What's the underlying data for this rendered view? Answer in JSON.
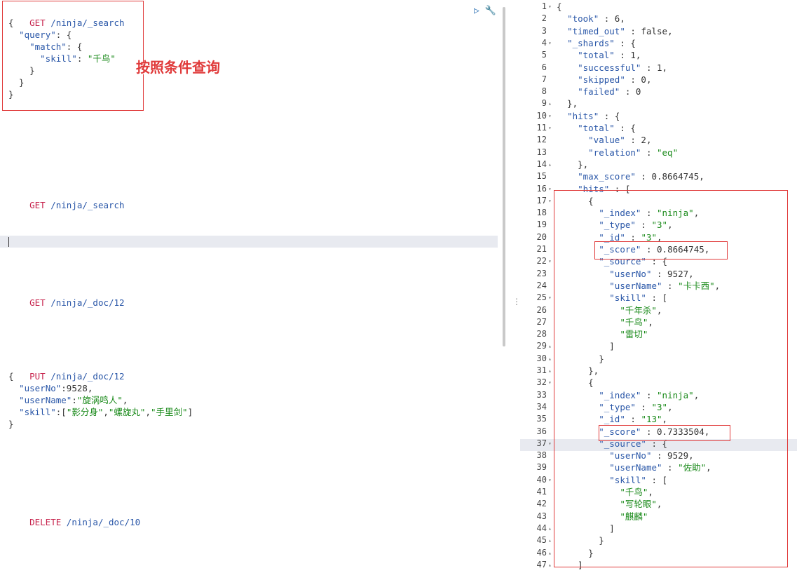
{
  "left_editor": {
    "blocks": [
      {
        "line": "GET /ninja/_search",
        "method": "GET",
        "path": "/ninja/_search"
      },
      {
        "line": "GET /ninja/_search",
        "method": "GET",
        "path": "/ninja/_search"
      },
      {
        "line": "GET /ninja/_doc/12",
        "method": "GET",
        "path": "/ninja/_doc/12"
      },
      {
        "line": "PUT /ninja/_doc/12",
        "method": "PUT",
        "path": "/ninja/_doc/12"
      },
      {
        "line": "DELETE /ninja/_doc/10",
        "method": "DELETE",
        "path": "/ninja/_doc/10"
      }
    ],
    "search_body": [
      "{",
      "  \"query\": {",
      "    \"match\": {",
      "      \"skill\": \"千鸟\"",
      "    }",
      "  }",
      "}"
    ],
    "put_body": [
      "{",
      "  \"userNo\":9528,",
      "  \"userName\":\"旋涡鸣人\",",
      "  \"skill\":[\"影分身\",\"螺旋丸\",\"手里剑\"]",
      "}"
    ],
    "run_icons": [
      "play-icon",
      "wrench-icon"
    ]
  },
  "annotation": "按照条件查询",
  "response": {
    "line_numbers": [
      "1",
      "2",
      "3",
      "4",
      "5",
      "6",
      "7",
      "8",
      "9",
      "10",
      "11",
      "12",
      "13",
      "14",
      "15",
      "16",
      "17",
      "18",
      "19",
      "20",
      "21",
      "22",
      "23",
      "24",
      "25",
      "26",
      "27",
      "28",
      "29",
      "30",
      "31",
      "32",
      "33",
      "34",
      "35",
      "36",
      "37",
      "38",
      "39",
      "40",
      "41",
      "42",
      "43",
      "44",
      "45",
      "46",
      "47"
    ],
    "lines": [
      "{",
      "  \"took\" : 6,",
      "  \"timed_out\" : false,",
      "  \"_shards\" : {",
      "    \"total\" : 1,",
      "    \"successful\" : 1,",
      "    \"skipped\" : 0,",
      "    \"failed\" : 0",
      "  },",
      "  \"hits\" : {",
      "    \"total\" : {",
      "      \"value\" : 2,",
      "      \"relation\" : \"eq\"",
      "    },",
      "    \"max_score\" : 0.8664745,",
      "    \"hits\" : [",
      "      {",
      "        \"_index\" : \"ninja\",",
      "        \"_type\" : \"3\",",
      "        \"_id\" : \"3\",",
      "        \"_score\" : 0.8664745,",
      "        \"_source\" : {",
      "          \"userNo\" : 9527,",
      "          \"userName\" : \"卡卡西\",",
      "          \"skill\" : [",
      "            \"千年杀\",",
      "            \"千鸟\",",
      "            \"雷切\"",
      "          ]",
      "        }",
      "      },",
      "      {",
      "        \"_index\" : \"ninja\",",
      "        \"_type\" : \"3\",",
      "        \"_id\" : \"13\",",
      "        \"_score\" : 0.7333504,",
      "        \"_source\" : {",
      "          \"userNo\" : 9529,",
      "          \"userName\" : \"佐助\",",
      "          \"skill\" : [",
      "            \"千鸟\",",
      "            \"写轮眼\",",
      "            \"麒麟\"",
      "          ]",
      "        }",
      "      }",
      "    ]"
    ],
    "fold_markers": {
      "1": "▾",
      "4": "▾",
      "9": "▴",
      "10": "▾",
      "11": "▾",
      "14": "▴",
      "16": "▾",
      "17": "▾",
      "22": "▾",
      "25": "▾",
      "29": "▴",
      "30": "▴",
      "31": "▴",
      "32": "▾",
      "37": "▾",
      "40": "▾",
      "44": "▴",
      "45": "▴",
      "46": "▴",
      "47": "▴"
    }
  },
  "colors": {
    "accent_red": "#e03a3a",
    "string_green": "#1a8a1a",
    "key_blue": "#2a57a8",
    "method_red": "#c7254e"
  }
}
